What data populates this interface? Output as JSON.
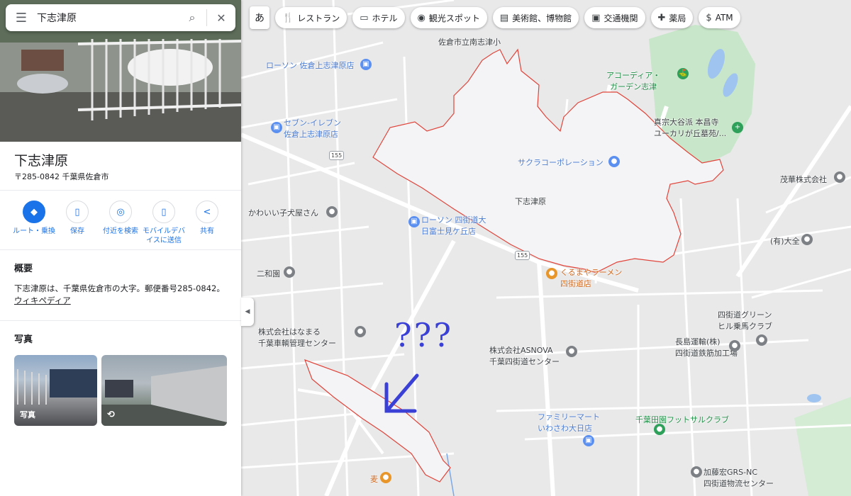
{
  "search": {
    "query": "下志津原",
    "menu_icon": "menu-icon",
    "search_icon": "search-icon",
    "clear_icon": "close-icon"
  },
  "place": {
    "name": "下志津原",
    "address": "〒285-0842 千葉県佐倉市"
  },
  "actions": [
    {
      "label": "ルート・乗換",
      "icon": "directions-icon"
    },
    {
      "label": "保存",
      "icon": "bookmark-icon"
    },
    {
      "label": "付近を検索",
      "icon": "nearby-icon"
    },
    {
      "label": "モバイルデバ\nイスに送信",
      "icon": "send-to-phone-icon"
    },
    {
      "label": "共有",
      "icon": "share-icon"
    }
  ],
  "overview": {
    "heading": "概要",
    "text": "下志津原は、千葉県佐倉市の大字。郵便番号285-0842。",
    "link": "ウィキペディア"
  },
  "photos": {
    "heading": "写真",
    "items": [
      {
        "label": "写真"
      },
      {
        "label": "",
        "icon": "street-view-icon"
      }
    ]
  },
  "ime": "あ",
  "chips": [
    {
      "label": "レストラン",
      "icon": "restaurant-icon"
    },
    {
      "label": "ホテル",
      "icon": "hotel-icon"
    },
    {
      "label": "観光スポット",
      "icon": "attraction-icon"
    },
    {
      "label": "美術館、博物館",
      "icon": "museum-icon"
    },
    {
      "label": "交通機関",
      "icon": "transit-icon"
    },
    {
      "label": "薬局",
      "icon": "pharmacy-icon"
    },
    {
      "label": "ATM",
      "icon": "atm-icon"
    }
  ],
  "map_labels": {
    "school": "佐倉市立南志津小",
    "lawson1": "ローソン 佐倉上志津原店",
    "accordia": "アコーディア・\nガーデン志津",
    "temple": "真宗大谷派 本昌寺\nユーカリが丘墓苑/...",
    "seven": "セブン-イレブン\n佐倉上志津原店",
    "sakura": "サクラコーポレーション",
    "area": "下志津原",
    "mohana": "茂華株式会社",
    "petshop": "かわいい子犬屋さん",
    "lawson2": "ローソン 四街道大\n日富士見ケ丘店",
    "daizen": "(有)大全",
    "niwaen": "二和園",
    "ramen": "くるまやラーメン\n四街道店",
    "green": "四街道グリーン\nヒル乗馬クラブ",
    "hanamaru": "株式会社はなまる\n千葉車輌管理センター",
    "asnova": "株式会社ASNOVA\n千葉四街道センター",
    "nagashima": "長島運輸(株)\n四街道鉄筋加工場",
    "family": "ファミリーマート\nいわさわ大日店",
    "futsal": "千葉田園フットサルクラブ",
    "kato": "加藤宏GRS-NC\n四街道物流センター",
    "mugi": "麦",
    "route1": "155",
    "route2": "155"
  },
  "annotation": {
    "text": "???",
    "color": "#3a3fd6"
  },
  "boundary_color": "#e0443a"
}
